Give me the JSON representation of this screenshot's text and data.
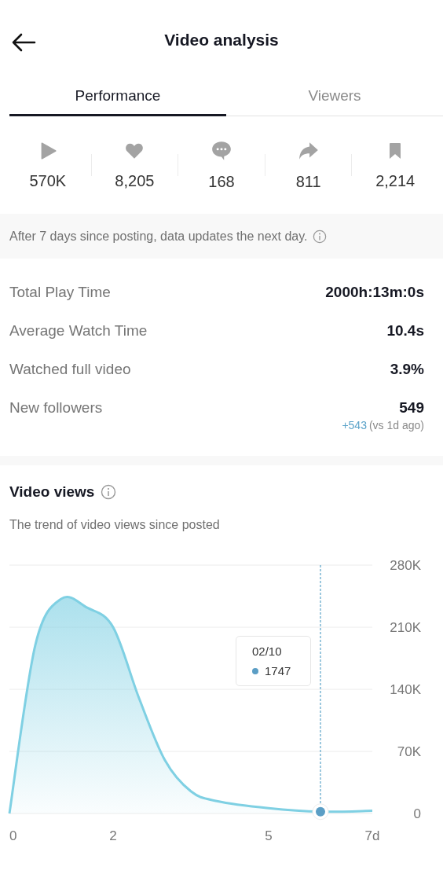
{
  "header": {
    "title": "Video analysis"
  },
  "tabs": [
    {
      "label": "Performance",
      "selected": true
    },
    {
      "label": "Viewers",
      "selected": false
    }
  ],
  "stats": [
    "570K",
    "8,205",
    "168",
    "811",
    "2,214"
  ],
  "notice": {
    "text": "After 7 days since posting, data updates the next day."
  },
  "metrics": [
    {
      "label": "Total Play Time",
      "value": "2000h:13m:0s"
    },
    {
      "label": "Average Watch Time",
      "value": "10.4s"
    },
    {
      "label": "Watched full video",
      "value": "3.9%"
    },
    {
      "label": "New followers",
      "value": "549",
      "delta": "+543",
      "delta_note": "(vs 1d ago)"
    }
  ],
  "views": {
    "title": "Video views",
    "subtitle": "The trend of video views since posted",
    "tooltip": {
      "date": "02/10",
      "value": "1747"
    },
    "chart_data": {
      "type": "area",
      "x": [
        0,
        0.5,
        1,
        1.5,
        2,
        2.5,
        3,
        3.5,
        4,
        5,
        6,
        7
      ],
      "series": [
        {
          "color": "#7fd0e3",
          "values": [
            0,
            190000,
            242000,
            232000,
            210000,
            130000,
            60000,
            25000,
            14000,
            6000,
            2000,
            3000
          ]
        }
      ],
      "grid": true,
      "ref_lines": [
        {
          "axis": "x",
          "value": 6
        }
      ],
      "xlim": [
        0,
        7
      ],
      "ylim": [
        0,
        280000
      ],
      "xticks": [
        0,
        2,
        5,
        {
          "value": 7,
          "label": "7d"
        }
      ],
      "yticks": [
        {
          "value": 0,
          "label": "0"
        },
        {
          "value": 70000,
          "label": "70K"
        },
        {
          "value": 140000,
          "label": "140K"
        },
        {
          "value": 210000,
          "label": "210K"
        },
        {
          "value": 280000,
          "label": "280K"
        }
      ]
    }
  }
}
